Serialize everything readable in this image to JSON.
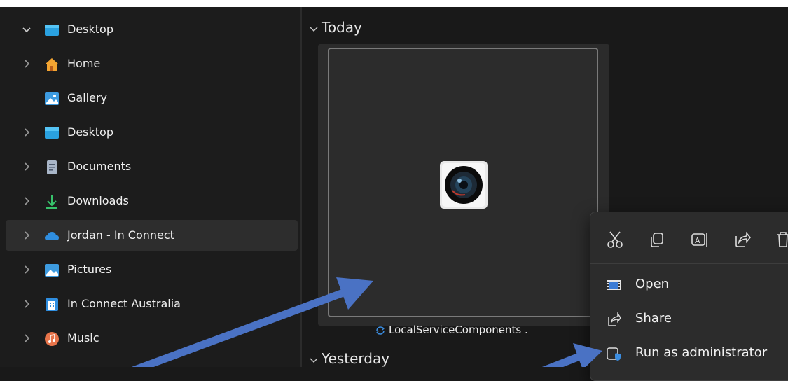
{
  "sidebar": {
    "items": [
      {
        "label": "Desktop",
        "expanded": true,
        "icon": "desktop-icon"
      },
      {
        "label": "Home",
        "icon": "home-icon"
      },
      {
        "label": "Gallery",
        "icon": "gallery-icon"
      },
      {
        "label": "Desktop",
        "icon": "desktop-icon"
      },
      {
        "label": "Documents",
        "icon": "document-icon"
      },
      {
        "label": "Downloads",
        "icon": "download-icon"
      },
      {
        "label": "Jordan - In Connect",
        "icon": "onedrive-cloud-icon",
        "selected": true
      },
      {
        "label": "Pictures",
        "icon": "pictures-icon"
      },
      {
        "label": "In Connect Australia",
        "icon": "building-icon"
      },
      {
        "label": "Music",
        "icon": "music-icon"
      }
    ]
  },
  "content": {
    "groups": [
      {
        "label": "Today"
      },
      {
        "label": "Yesterday"
      }
    ],
    "file": {
      "name": "LocalServiceComponents .",
      "icon": "camera-app-icon",
      "status_icon": "sync-icon"
    }
  },
  "context_menu": {
    "toolbar": [
      "cut-icon",
      "copy-icon",
      "rename-icon",
      "share-icon",
      "delete-icon"
    ],
    "items": [
      {
        "label": "Open",
        "icon": "open-app-icon"
      },
      {
        "label": "Share",
        "icon": "share-icon"
      },
      {
        "label": "Run as administrator",
        "icon": "shield-admin-icon"
      }
    ]
  },
  "colors": {
    "background": "#191919",
    "sidebar": "#1c1c1c",
    "selected": "#2d2d2d",
    "menu": "#2c2c2c",
    "arrow": "#4a72c4"
  }
}
